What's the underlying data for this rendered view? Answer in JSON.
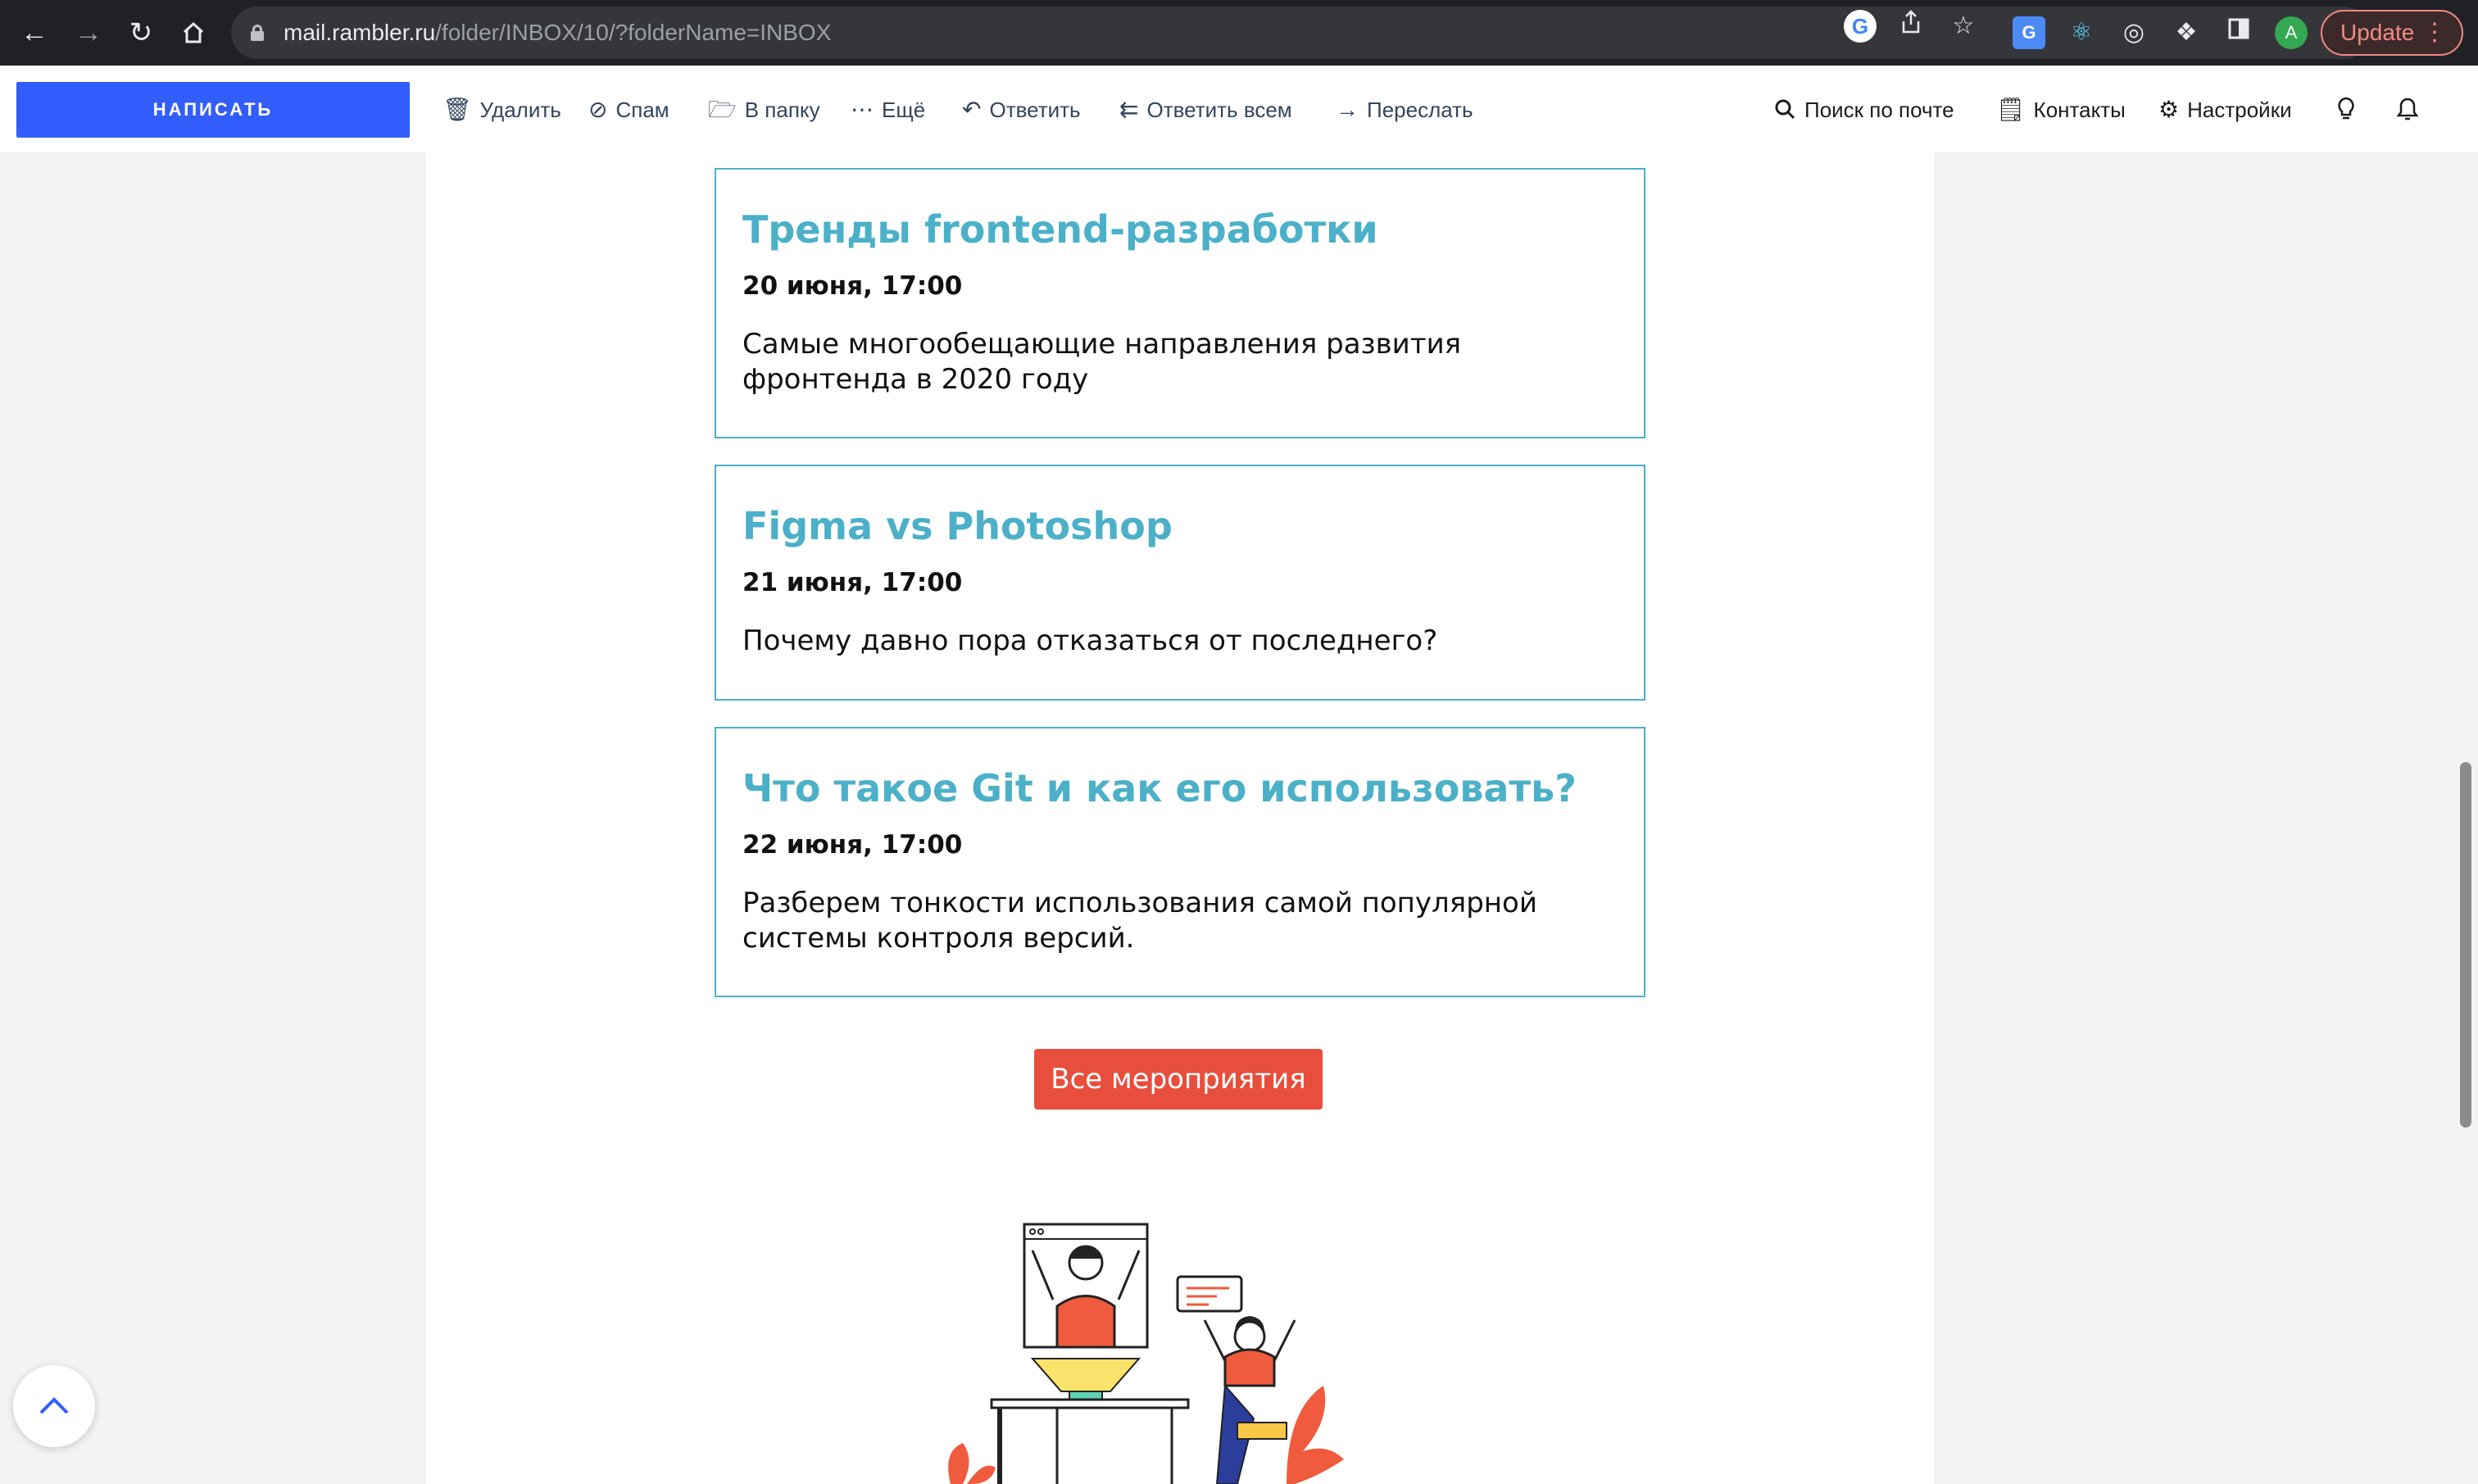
{
  "browser": {
    "url_host": "mail.rambler.ru",
    "url_path": "/folder/INBOX/10/?folderName=INBOX",
    "avatar_letter": "A",
    "update_label": "Update"
  },
  "toolbar": {
    "compose_label": "НАПИСАТЬ",
    "delete_label": "Удалить",
    "spam_label": "Спам",
    "move_label": "В папку",
    "more_label": "Ещё",
    "reply_label": "Ответить",
    "reply_all_label": "Ответить всем",
    "forward_label": "Переслать",
    "search_label": "Поиск по почте",
    "contacts_label": "Контакты",
    "settings_label": "Настройки"
  },
  "events": [
    {
      "title": "Тренды frontend-разработки",
      "date": "20 июня, 17:00",
      "description": "Самые многообещающие направления развития фронтенда в 2020 году"
    },
    {
      "title": "Figma vs Photoshop",
      "date": "21 июня, 17:00",
      "description": "Почему давно пора отказаться от последнего?"
    },
    {
      "title": "Что такое Git и как его использовать?",
      "date": "22 июня, 17:00",
      "description": "Разберем тонкости использования самой популярной системы контроля версий."
    }
  ],
  "all_events_label": "Все мероприятия",
  "colors": {
    "accent_blue": "#315efb",
    "event_title": "#4bb0c8",
    "button_red": "#e84e3c"
  }
}
